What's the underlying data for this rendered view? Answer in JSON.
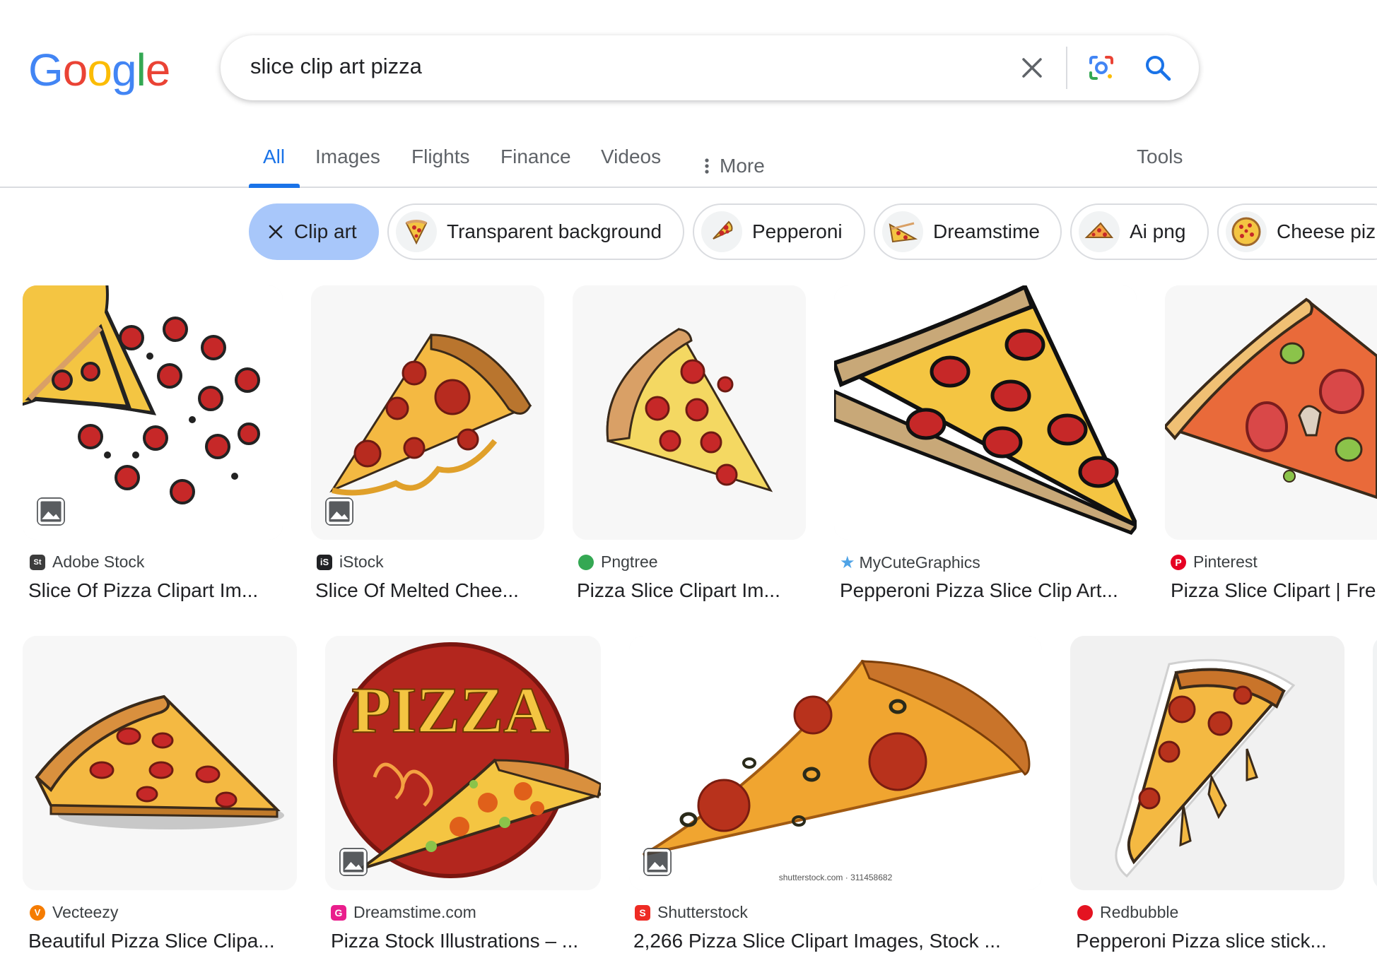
{
  "search": {
    "query": "slice clip art pizza"
  },
  "tabs": [
    {
      "label": "All"
    },
    {
      "label": "Images"
    },
    {
      "label": "Flights"
    },
    {
      "label": "Finance"
    },
    {
      "label": "Videos"
    },
    {
      "label": "More"
    },
    {
      "label": "Tools"
    }
  ],
  "chips": [
    {
      "label": "Clip art",
      "selected": true
    },
    {
      "label": "Transparent background"
    },
    {
      "label": "Pepperoni"
    },
    {
      "label": "Dreamstime"
    },
    {
      "label": "Ai png"
    },
    {
      "label": "Cheese piz"
    }
  ],
  "results": [
    {
      "source": "Adobe Stock",
      "title": "Slice Of Pizza Clipart Im...",
      "favicon_color": "#3c3c3c"
    },
    {
      "source": "iStock",
      "title": "Slice Of Melted Chee...",
      "favicon_color": "#202124"
    },
    {
      "source": "Pngtree",
      "title": "Pizza Slice Clipart Im...",
      "favicon_color": "#34a853"
    },
    {
      "source": "MyCuteGraphics",
      "title": "Pepperoni Pizza Slice Clip Art...",
      "favicon_color": "#4fa3e6"
    },
    {
      "source": "Pinterest",
      "title": "Pizza Slice Clipart | Fre",
      "favicon_color": "#e60023"
    },
    {
      "source": "Vecteezy",
      "title": "Beautiful Pizza Slice Clipa...",
      "favicon_color": "#f57c00"
    },
    {
      "source": "Dreamstime.com",
      "title": "Pizza Stock Illustrations – ...",
      "favicon_color": "#e91e8c"
    },
    {
      "source": "Shutterstock",
      "title": "2,266 Pizza Slice Clipart Images, Stock ...",
      "favicon_color": "#ee2b24"
    },
    {
      "source": "Redbubble",
      "title": "Pepperoni Pizza slice stick...",
      "favicon_color": "#e41321"
    }
  ],
  "image_text": {
    "pizza_sign": "PIZZA",
    "watermark": "shutterstock.com · 311458682"
  },
  "colors": {
    "accent": "#1a73e8",
    "chip_selected": "#a8c7fa",
    "cheese": "#f4c542",
    "pepperoni": "#c62828",
    "crust": "#d9a066"
  }
}
